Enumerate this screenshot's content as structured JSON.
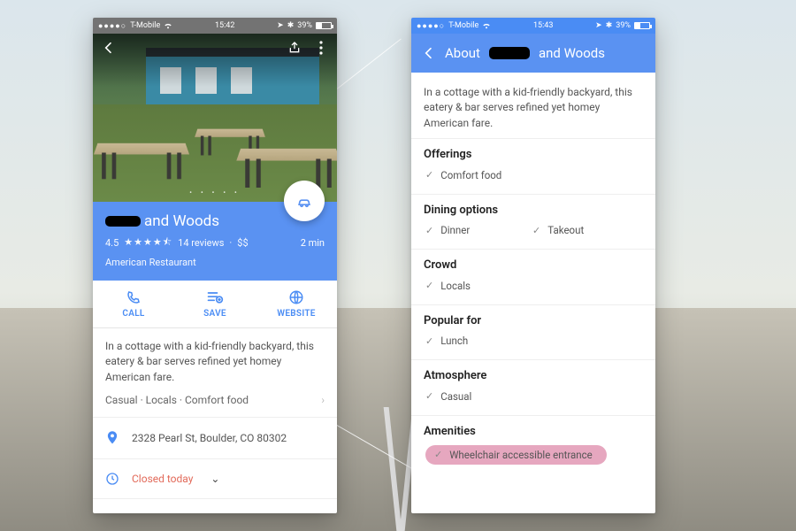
{
  "status": {
    "carrier": "T-Mobile",
    "time_left": "15:42",
    "time_right": "15:43",
    "battery_pct": "39%"
  },
  "place": {
    "name_suffix": "and Woods",
    "rating": "4.5",
    "stars_glyph": "★★★★½",
    "reviews": "14 reviews",
    "price": "$$",
    "eta": "2 min",
    "category": "American Restaurant",
    "description": "In a cottage with a kid-friendly backyard, this eatery & bar serves refined yet homey American fare.",
    "tags": "Casual · Locals · Comfort food",
    "address": "2328 Pearl St, Boulder, CO 80302",
    "hours_status": "Closed today"
  },
  "actions": {
    "call": "CALL",
    "save": "SAVE",
    "website": "WEBSITE"
  },
  "about": {
    "header_prefix": "About",
    "header_suffix": "and Woods",
    "sections": [
      {
        "title": "Offerings",
        "items": [
          "Comfort food"
        ]
      },
      {
        "title": "Dining options",
        "items": [
          "Dinner",
          "Takeout"
        ]
      },
      {
        "title": "Crowd",
        "items": [
          "Locals"
        ]
      },
      {
        "title": "Popular for",
        "items": [
          "Lunch"
        ]
      },
      {
        "title": "Atmosphere",
        "items": [
          "Casual"
        ]
      },
      {
        "title": "Amenities",
        "items": [
          "Wheelchair accessible entrance"
        ],
        "highlight": 0
      }
    ]
  }
}
